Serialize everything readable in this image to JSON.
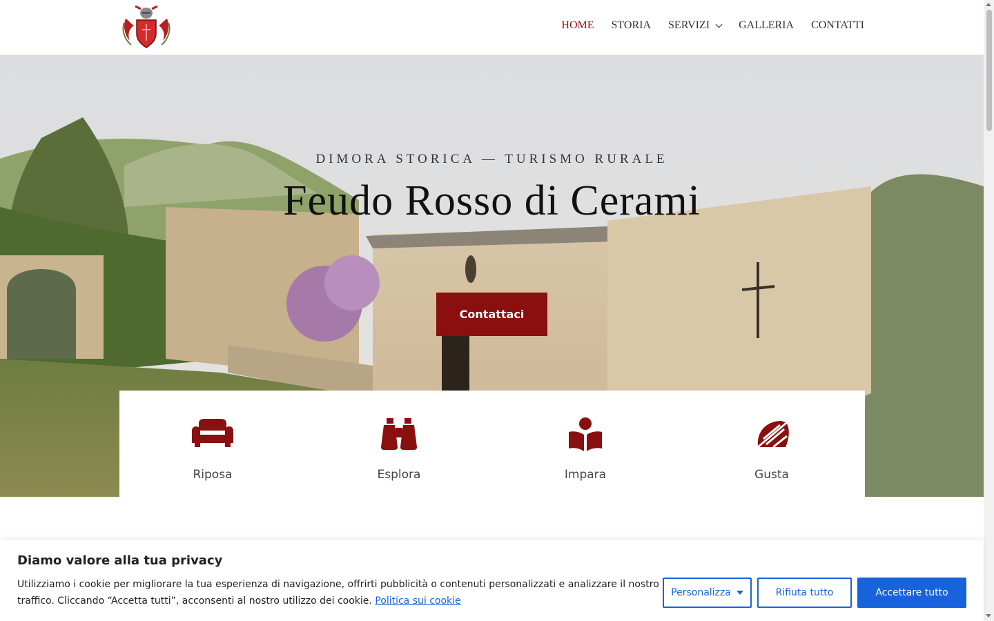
{
  "header": {
    "logo_alt": "Stemma Feudo Rosso",
    "nav": [
      {
        "label": "HOME",
        "active": true
      },
      {
        "label": "STORIA"
      },
      {
        "label": "SERVIZI"
      },
      {
        "label": "GALLERIA"
      },
      {
        "label": "CONTATTI"
      }
    ]
  },
  "hero": {
    "subtitle": "DIMORA STORICA — TURISMO RURALE",
    "title": "Feudo Rosso di Cerami",
    "button": "Contattaci"
  },
  "features": [
    {
      "label": "Riposa",
      "icon": "sofa-icon"
    },
    {
      "label": "Esplora",
      "icon": "binoculars-icon"
    },
    {
      "label": "Impara",
      "icon": "reading-icon"
    },
    {
      "label": "Gusta",
      "icon": "pizza-slice-icon"
    }
  ],
  "cookie": {
    "title": "Diamo valore alla tua privacy",
    "text": "Utilizziamo i cookie per migliorare la tua esperienza di navigazione, offrirti pubblicità o contenuti personalizzati e analizzare il nostro traffico. Cliccando “Accetta tutti”, acconsenti al nostro utilizzo dei cookie.",
    "link": "Politica sui cookie",
    "customize": "Personalizza",
    "reject": "Rifiuta tutto",
    "accept": "Accettare tutto"
  },
  "colors": {
    "brand_red": "#8a0f0f",
    "cookie_blue": "#1863dc"
  }
}
